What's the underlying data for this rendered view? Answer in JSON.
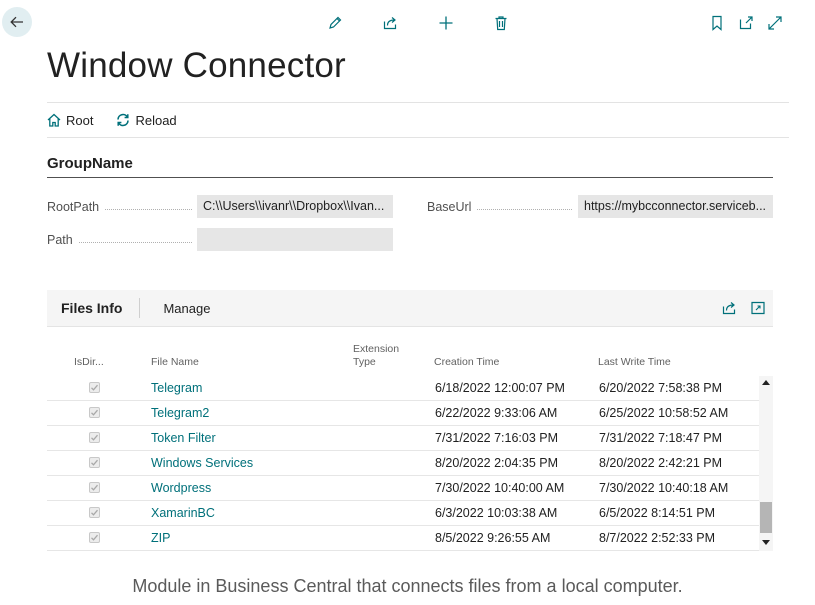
{
  "page": {
    "title": "Window Connector"
  },
  "actions": [
    {
      "label": "Root",
      "icon": "home-icon"
    },
    {
      "label": "Reload",
      "icon": "refresh-icon"
    }
  ],
  "toolbar": {
    "icons": [
      "back-arrow-icon",
      "edit-icon",
      "share-icon",
      "add-icon",
      "delete-icon",
      "bookmark-icon",
      "open-in-new-window-icon",
      "expand-icon"
    ]
  },
  "group": {
    "title": "GroupName",
    "fields": {
      "root_path": {
        "label": "RootPath",
        "value": "C:\\\\Users\\\\ivanr\\\\Dropbox\\\\Ivan..."
      },
      "base_url": {
        "label": "BaseUrl",
        "value": "https://mybcconnector.serviceb..."
      },
      "path": {
        "label": "Path",
        "value": ""
      }
    }
  },
  "files": {
    "title": "Files Info",
    "manage_label": "Manage",
    "columns": {
      "is_dir": "IsDir...",
      "file_name": "File Name",
      "extension_type": "Extension\nType",
      "creation_time": "Creation Time",
      "last_write_time": "Last Write Time"
    },
    "rows": [
      {
        "name": "Telegram",
        "checked": true,
        "extension": "",
        "created": "6/18/2022 12:00:07 PM",
        "modified": "6/20/2022 7:58:38 PM"
      },
      {
        "name": "Telegram2",
        "checked": true,
        "extension": "",
        "created": "6/22/2022 9:33:06 AM",
        "modified": "6/25/2022 10:58:52 AM"
      },
      {
        "name": "Token Filter",
        "checked": true,
        "extension": "",
        "created": "7/31/2022 7:16:03 PM",
        "modified": "7/31/2022 7:18:47 PM"
      },
      {
        "name": "Windows Services",
        "checked": true,
        "extension": "",
        "created": "8/20/2022 2:04:35 PM",
        "modified": "8/20/2022 2:42:21 PM"
      },
      {
        "name": "Wordpress",
        "checked": true,
        "extension": "",
        "created": "7/30/2022 10:40:00 AM",
        "modified": "7/30/2022 10:40:18 AM"
      },
      {
        "name": "XamarinBC",
        "checked": true,
        "extension": "",
        "created": "6/3/2022 10:03:38 AM",
        "modified": "6/5/2022 8:14:51 PM"
      },
      {
        "name": "ZIP",
        "checked": true,
        "extension": "",
        "created": "8/5/2022 9:26:55 AM",
        "modified": "8/7/2022 2:52:33 PM"
      }
    ]
  },
  "caption": "Module in Business Central that connects files from a local computer.",
  "colors": {
    "accent": "#00707a",
    "back_button_bg": "#e1eef1",
    "field_bg": "#e6e6e6",
    "part_header_bg": "#f5f5f5"
  }
}
